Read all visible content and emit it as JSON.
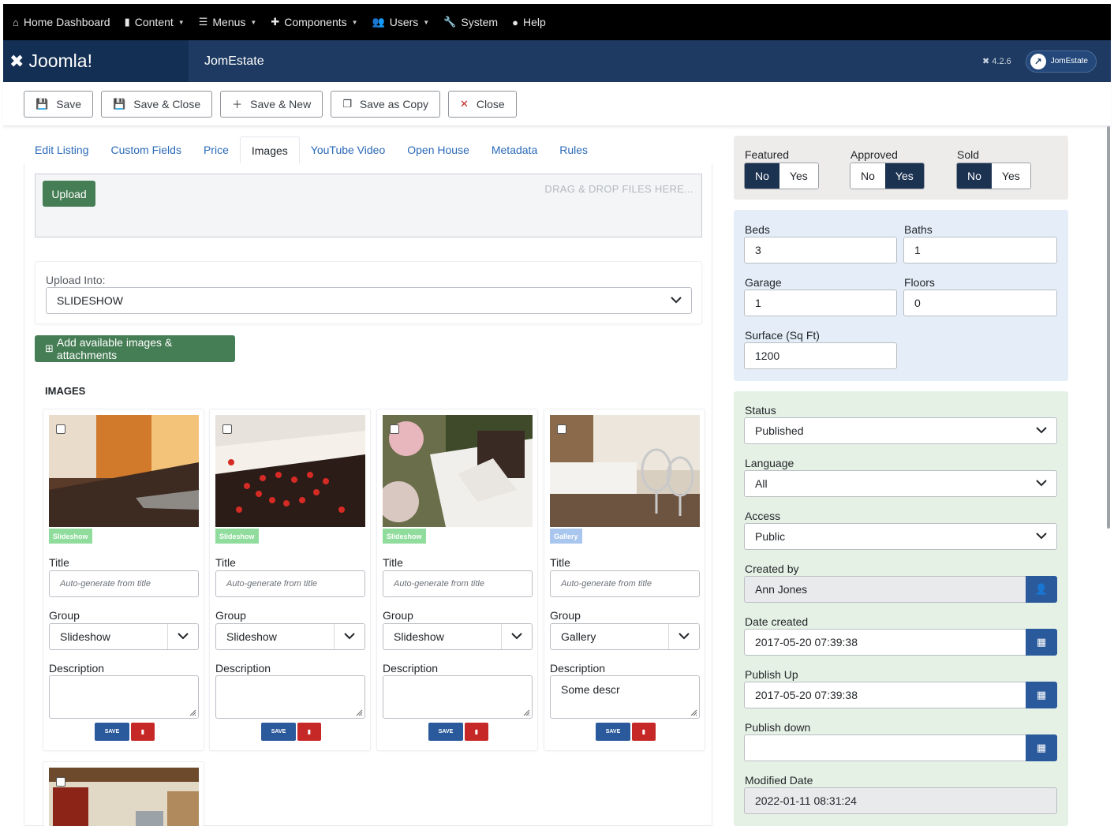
{
  "topmenu": {
    "home": "Home Dashboard",
    "content": "Content",
    "menus": "Menus",
    "components": "Components",
    "users": "Users",
    "system": "System",
    "help": "Help"
  },
  "header": {
    "brand": "Joomla!",
    "title": "JomEstate",
    "version": "4.2.6",
    "site_button": "JomEstate"
  },
  "toolbar": {
    "save": "Save",
    "save_close": "Save & Close",
    "save_new": "Save & New",
    "save_copy": "Save as Copy",
    "close": "Close"
  },
  "tabs": [
    "Edit Listing",
    "Custom Fields",
    "Price",
    "Images",
    "YouTube Video",
    "Open House",
    "Metadata",
    "Rules"
  ],
  "upload": {
    "button": "Upload",
    "drop_hint": "DRAG & DROP FILES HERE...",
    "upload_into_label": "Upload Into:",
    "upload_into_value": "SLIDESHOW",
    "add_button": "Add available images & attachments",
    "images_heading": "IMAGES"
  },
  "image_cards": [
    {
      "badge": "Slideshow",
      "title_label": "Title",
      "title_placeholder": "Auto-generate from title",
      "group_label": "Group",
      "group": "Slideshow",
      "desc_label": "Description",
      "desc": "",
      "save": "SAVE"
    },
    {
      "badge": "Slideshow",
      "title_label": "Title",
      "title_placeholder": "Auto-generate from title",
      "group_label": "Group",
      "group": "Slideshow",
      "desc_label": "Description",
      "desc": "",
      "save": "SAVE"
    },
    {
      "badge": "Slideshow",
      "title_label": "Title",
      "title_placeholder": "Auto-generate from title",
      "group_label": "Group",
      "group": "Slideshow",
      "desc_label": "Description",
      "desc": "",
      "save": "SAVE"
    },
    {
      "badge": "Gallery",
      "title_label": "Title",
      "title_placeholder": "Auto-generate from title",
      "group_label": "Group",
      "group": "Gallery",
      "desc_label": "Description",
      "desc": "Some descr",
      "save": "SAVE"
    }
  ],
  "colors": {
    "badge_slideshow": "#8fdc9c",
    "badge_gallery": "#a8c6ee",
    "accent_green": "#457d54",
    "accent_blue": "#2a5a9b",
    "danger": "#c52827"
  },
  "sidebar": {
    "featured": {
      "label": "Featured",
      "no": "No",
      "yes": "Yes",
      "selected": "No"
    },
    "approved": {
      "label": "Approved",
      "no": "No",
      "yes": "Yes",
      "selected": "Yes"
    },
    "sold": {
      "label": "Sold",
      "no": "No",
      "yes": "Yes",
      "selected": "No"
    },
    "beds_label": "Beds",
    "beds": "3",
    "baths_label": "Baths",
    "baths": "1",
    "garage_label": "Garage",
    "garage": "1",
    "floors_label": "Floors",
    "floors": "0",
    "surface_label": "Surface (Sq Ft)",
    "surface": "1200",
    "status_label": "Status",
    "status": "Published",
    "language_label": "Language",
    "language": "All",
    "access_label": "Access",
    "access": "Public",
    "created_by_label": "Created by",
    "created_by": "Ann Jones",
    "date_created_label": "Date created",
    "date_created": "2017-05-20 07:39:38",
    "publish_up_label": "Publish Up",
    "publish_up": "2017-05-20 07:39:38",
    "publish_down_label": "Publish down",
    "publish_down": "",
    "modified_label": "Modified Date",
    "modified": "2022-01-11 08:31:24"
  }
}
